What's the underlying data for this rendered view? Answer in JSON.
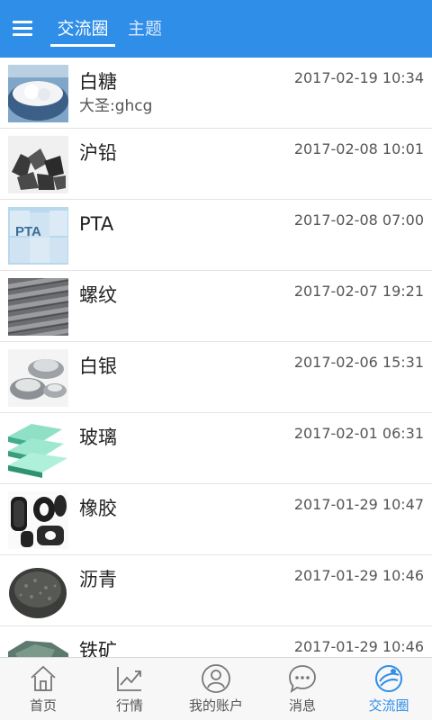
{
  "header": {
    "tabs": [
      {
        "label": "交流圈",
        "active": true
      },
      {
        "label": "主题",
        "active": false
      }
    ],
    "accent_color": "#2f8ee8",
    "menu_icon": "hamburger-menu-icon"
  },
  "list": {
    "items": [
      {
        "name": "白糖",
        "subtitle": "大圣:ghcg",
        "date": "2017-02-19 10:34"
      },
      {
        "name": "沪铅",
        "subtitle": "",
        "date": "2017-02-08 10:01"
      },
      {
        "name": "PTA",
        "subtitle": "",
        "date": "2017-02-08 07:00",
        "thumb_text": "PTA"
      },
      {
        "name": "螺纹",
        "subtitle": "",
        "date": "2017-02-07 19:21"
      },
      {
        "name": "白银",
        "subtitle": "",
        "date": "2017-02-06 15:31"
      },
      {
        "name": "玻璃",
        "subtitle": "",
        "date": "2017-02-01 06:31"
      },
      {
        "name": "橡胶",
        "subtitle": "",
        "date": "2017-01-29 10:47"
      },
      {
        "name": "沥青",
        "subtitle": "",
        "date": "2017-01-29 10:46"
      },
      {
        "name": "铁矿",
        "subtitle": "",
        "date": "2017-01-29 10:46"
      }
    ]
  },
  "bottom_nav": [
    {
      "label": "首页",
      "icon": "home-icon",
      "active": false
    },
    {
      "label": "行情",
      "icon": "market-chart-icon",
      "active": false
    },
    {
      "label": "我的账户",
      "icon": "account-icon",
      "active": false
    },
    {
      "label": "消息",
      "icon": "message-icon",
      "active": false
    },
    {
      "label": "交流圈",
      "icon": "community-icon",
      "active": true
    }
  ]
}
